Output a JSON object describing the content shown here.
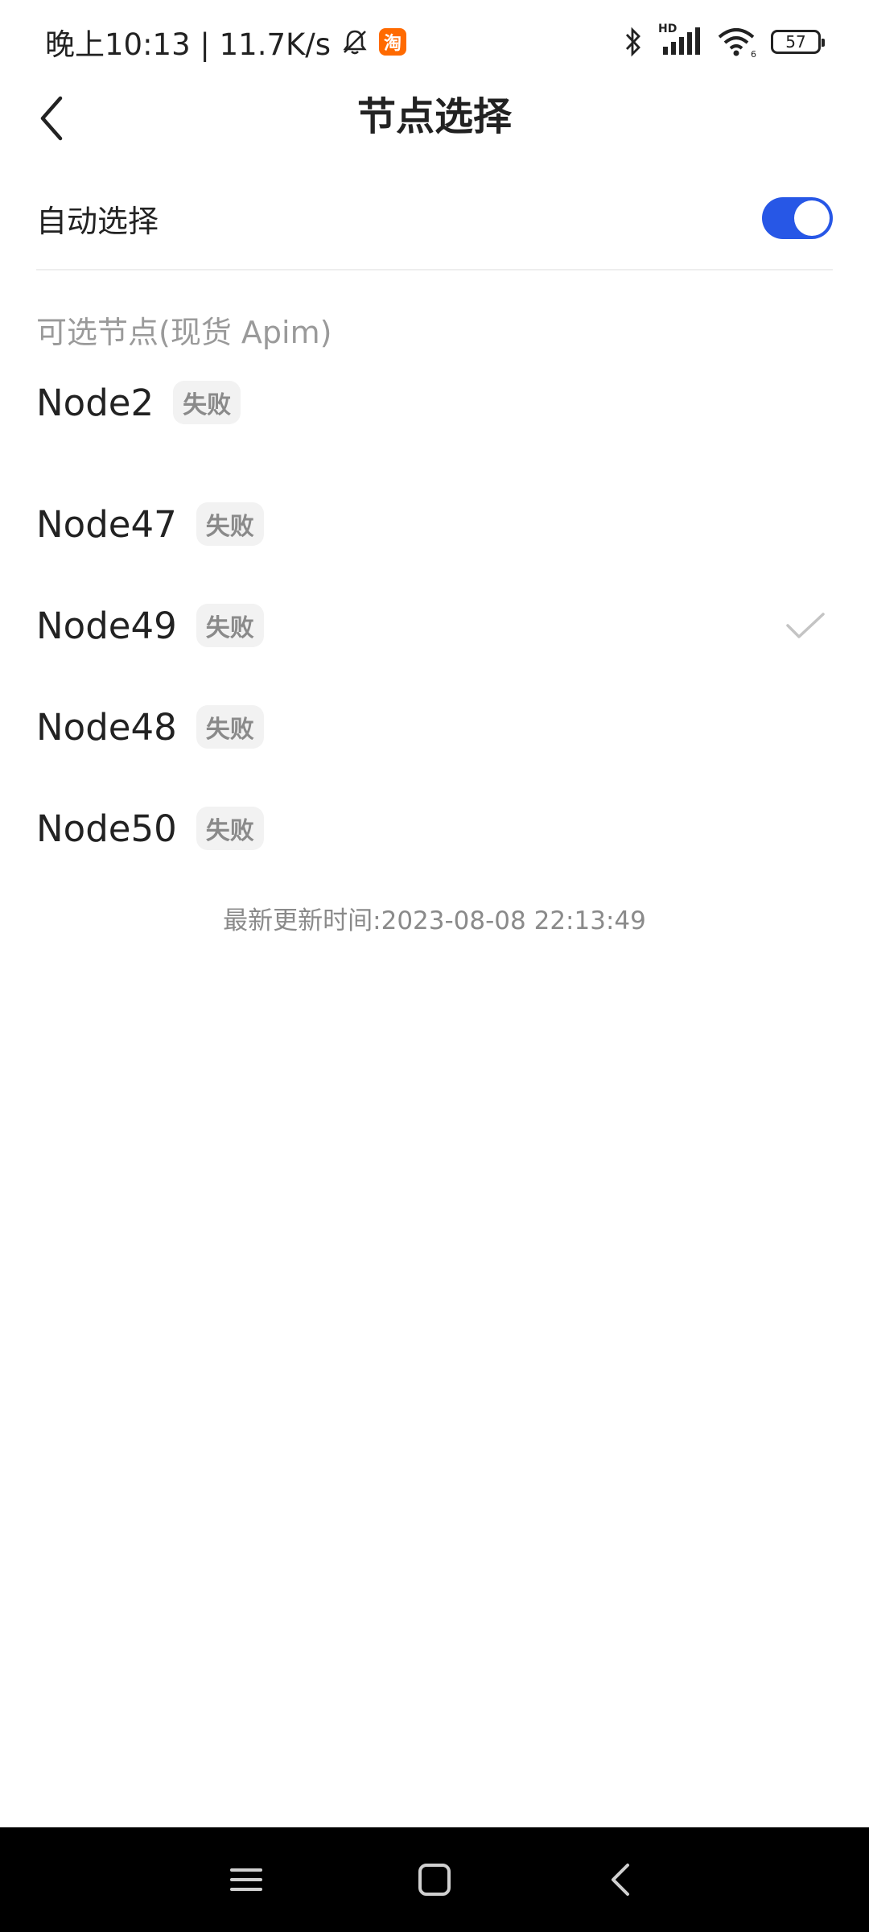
{
  "status_bar": {
    "time_text": "晚上10:13 | 11.7K/s",
    "app_badge": "淘",
    "hd_label": "HD",
    "battery_level": "57",
    "icons": [
      "mute-bell-icon",
      "bluetooth-icon",
      "cell-signal-icon",
      "wifi-icon",
      "battery-icon"
    ]
  },
  "header": {
    "title": "节点选择",
    "back_icon": "back-chevron-icon"
  },
  "auto_select": {
    "label": "自动选择",
    "enabled": true,
    "accent_color": "#2757e6"
  },
  "section": {
    "label": "可选节点(现货 Apim)"
  },
  "nodes": [
    {
      "name": "Node2",
      "status": "失败",
      "selected": false
    },
    {
      "name": "Node47",
      "status": "失败",
      "selected": false
    },
    {
      "name": "Node49",
      "status": "失败",
      "selected": true
    },
    {
      "name": "Node48",
      "status": "失败",
      "selected": false
    },
    {
      "name": "Node50",
      "status": "失败",
      "selected": false
    }
  ],
  "updated_time": "最新更新时间:2023-08-08 22:13:49",
  "nav_bar": {
    "buttons": [
      "menu-icon",
      "home-icon",
      "back-icon"
    ]
  }
}
